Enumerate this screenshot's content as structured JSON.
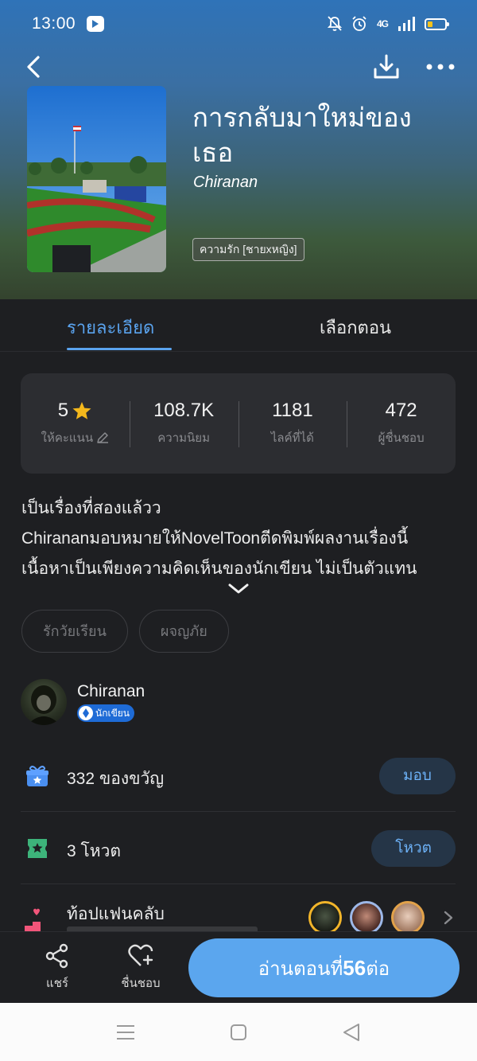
{
  "status_bar": {
    "time": "13:00",
    "network": "4G"
  },
  "book": {
    "title": "การกลับมาใหม่ของเธอ",
    "title_line1": "การกลับมาใหม่ของ",
    "title_line2": "เธอ",
    "author": "Chiranan",
    "genre_tag": "ความรัก [ชายxหญิง]"
  },
  "tabs": [
    {
      "label": "รายละเอียด",
      "active": true
    },
    {
      "label": "เลือกตอน",
      "active": false
    }
  ],
  "stats": [
    {
      "value": "5",
      "label": "ให้คะแนน"
    },
    {
      "value": "108.7K",
      "label": "ความนิยม"
    },
    {
      "value": "1181",
      "label": "ไลค์ที่ได้"
    },
    {
      "value": "472",
      "label": "ผู้ชื่นชอบ"
    }
  ],
  "description": {
    "lines": [
      "เป็นเรื่องที่สองแล้วว",
      "Chirananมอบหมายให้NovelToonตีดพิมพ์ผลงานเรื่องนี้",
      "เนื้อหาเป็นเพียงความคิดเห็นของนักเขียน ไม่เป็นตัวแทน"
    ]
  },
  "tags": [
    "รักวัยเรียน",
    "ผจญภัย"
  ],
  "author_section": {
    "name": "Chiranan",
    "badge": "นักเขียน"
  },
  "gift_row": {
    "text": "332 ของขวัญ",
    "button": "มอบ"
  },
  "vote_row": {
    "text": "3 โหวต",
    "button": "โหวต"
  },
  "fanclub": {
    "title": "ท้อปแฟนคลับ"
  },
  "action_bar": {
    "share_label": "แชร์",
    "like_label": "ชื่นชอบ",
    "read_prefix": "อ่านตอนที่",
    "read_number": "56",
    "read_suffix": "ต่อ"
  },
  "colors": {
    "accent": "#5aa3ee",
    "background": "#1e1f22",
    "card": "#2c2d31",
    "star": "#f4b81c",
    "gift_icon": "#4a8ff0",
    "vote_icon": "#3db37a"
  },
  "icons": {
    "back": "back-arrow-icon",
    "download": "download-icon",
    "more": "more-dots-icon",
    "star": "star-icon",
    "edit": "pencil-icon",
    "gift": "gift-icon",
    "vote": "ticket-icon",
    "fanclub": "podium-icon",
    "share": "share-icon",
    "like": "heart-plus-icon"
  }
}
